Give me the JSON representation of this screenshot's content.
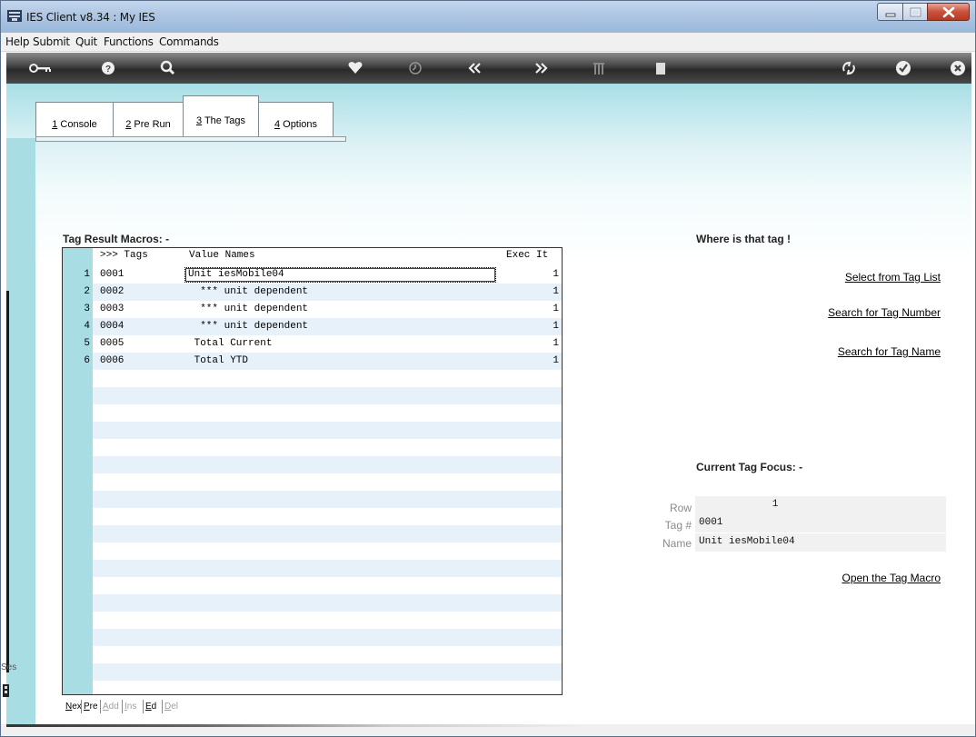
{
  "window": {
    "title": "IES Client v8.34 : My IES"
  },
  "menu": [
    "Help",
    "Submit",
    "Quit",
    "Functions",
    "Commands"
  ],
  "toolbar": {
    "icons": [
      "key-icon",
      "help-icon",
      "search-icon",
      "heart-icon",
      "clock-icon",
      "back-icon",
      "forward-icon",
      "columns-icon",
      "page-icon",
      "recycle-icon",
      "check-icon",
      "close-icon"
    ]
  },
  "tabs": [
    {
      "num": "1",
      "label": " Console"
    },
    {
      "num": "2",
      "label": " Pre Run"
    },
    {
      "num": "3",
      "label": " The Tags"
    },
    {
      "num": "4",
      "label": " Options"
    }
  ],
  "macros": {
    "title": "Tag Result Macros: -",
    "columns": {
      "tags": ">>> Tags",
      "value_names": "Value Names",
      "exec": "Exec It"
    },
    "rows": [
      {
        "num": "1",
        "tag": "0001",
        "value": "Unit iesMobile04",
        "exec": "1"
      },
      {
        "num": "2",
        "tag": "0002",
        "value": "  *** unit dependent",
        "exec": "1"
      },
      {
        "num": "3",
        "tag": "0003",
        "value": "  *** unit dependent",
        "exec": "1"
      },
      {
        "num": "4",
        "tag": "0004",
        "value": "  *** unit dependent",
        "exec": "1"
      },
      {
        "num": "5",
        "tag": "0005",
        "value": " Total Current",
        "exec": "1"
      },
      {
        "num": "6",
        "tag": "0006",
        "value": " Total YTD",
        "exec": "1"
      }
    ]
  },
  "nav_buttons": [
    {
      "u": "N",
      "rest": "ex",
      "enabled": true
    },
    {
      "u": "P",
      "rest": "re",
      "enabled": true
    },
    {
      "u": "A",
      "rest": "dd",
      "enabled": false
    },
    {
      "u": "I",
      "rest": "ns",
      "enabled": false
    },
    {
      "u": "E",
      "rest": "d",
      "enabled": true
    },
    {
      "u": "D",
      "rest": "el",
      "enabled": false
    }
  ],
  "where": {
    "title": "Where is that tag !",
    "select_list": "Select from Tag List",
    "search_number": "Search for Tag Number",
    "search_name": "Search for Tag Name"
  },
  "focus": {
    "title": "Current Tag Focus: -",
    "row_label": "Row",
    "row_value": "1",
    "tag_label": "Tag #",
    "tag_value": "0001",
    "name_label": "Name",
    "name_value": "Unit iesMobile04",
    "open_macro": "Open the Tag Macro"
  },
  "session": {
    "fragment": "Ses"
  }
}
